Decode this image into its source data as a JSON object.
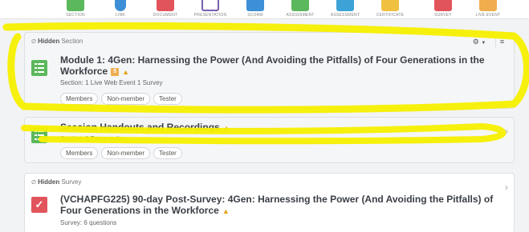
{
  "toolbar": {
    "items": [
      {
        "label": "SECTION",
        "color": "#5cb85c"
      },
      {
        "label": "LINK",
        "color": "#3d8fd6"
      },
      {
        "label": "DOCUMENT",
        "color": "#e2545c"
      },
      {
        "label": "PRESENTATION",
        "color": "#7a5fb0"
      },
      {
        "label": "SCORM",
        "color": "#3d8fd6"
      },
      {
        "label": "ASSIGNMENT",
        "color": "#5cb85c"
      },
      {
        "label": "ASSESSMENT",
        "color": "#3da3d6"
      },
      {
        "label": "CERTIFICATE",
        "color": "#f0c040"
      },
      {
        "label": "SURVEY",
        "color": "#e2545c"
      },
      {
        "label": "LIVE EVENT",
        "color": "#f0ad4e"
      }
    ]
  },
  "cards": [
    {
      "hidden_strong": "Hidden",
      "hidden_type": "Section",
      "title_line1": "Module 1: 4Gen: Harnessing the Power (And Avoiding the Pitfalls) of Four Generations in the",
      "title_line2": "Workforce",
      "badge": "5",
      "subtitle": "Section: 1 Live Web Event  1 Survey",
      "tags": [
        "Members",
        "Non-member",
        "Tester"
      ]
    },
    {
      "title": "Session Handouts and Recordings",
      "subtitle": "Section: 1 Presentation",
      "tags": [
        "Members",
        "Non-member",
        "Tester"
      ]
    },
    {
      "hidden_strong": "Hidden",
      "hidden_type": "Survey",
      "title_line1": "(VCHAPFG225) 90-day Post-Survey: 4Gen: Harnessing the Power (And Avoiding the Pitfalls) of",
      "title_line2": "Four Generations in the Workforce",
      "subtitle": "Survey: 6 questions"
    }
  ],
  "icons": {
    "gear": "gear-icon",
    "menu": "hamburger-menu-icon",
    "lock": "lock-icon",
    "chevron": "chevron-right-icon",
    "eye": "eye-slash-icon"
  },
  "colors": {
    "highlighter": "#f5ef00",
    "lock": "#e6a11a",
    "section_green": "#5cb85c",
    "survey_red": "#e2545c"
  }
}
